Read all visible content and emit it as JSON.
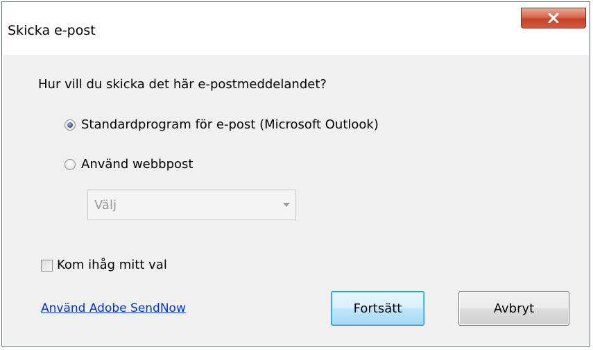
{
  "window": {
    "title": "Skicka e-post",
    "close_label": "x"
  },
  "dialog": {
    "prompt": "Hur vill du skicka det här e-postmeddelandet?",
    "options": [
      {
        "label": "Standardprogram för e-post (Microsoft Outlook)",
        "checked": true
      },
      {
        "label": "Använd webbpost",
        "checked": false
      }
    ],
    "webmail_select": {
      "value": "Välj",
      "enabled": false
    },
    "remember_choice": {
      "label": "Kom ihåg mitt val",
      "checked": false
    },
    "adobe_link": "Använd Adobe SendNow",
    "buttons": {
      "continue": "Fortsätt",
      "cancel": "Avbryt"
    }
  },
  "colors": {
    "link": "#0033cc",
    "close_button": "#c4422a",
    "default_button_border": "#3c7fb1"
  },
  "icons": {
    "close": "close-icon",
    "dropdown": "chevron-down-icon"
  }
}
